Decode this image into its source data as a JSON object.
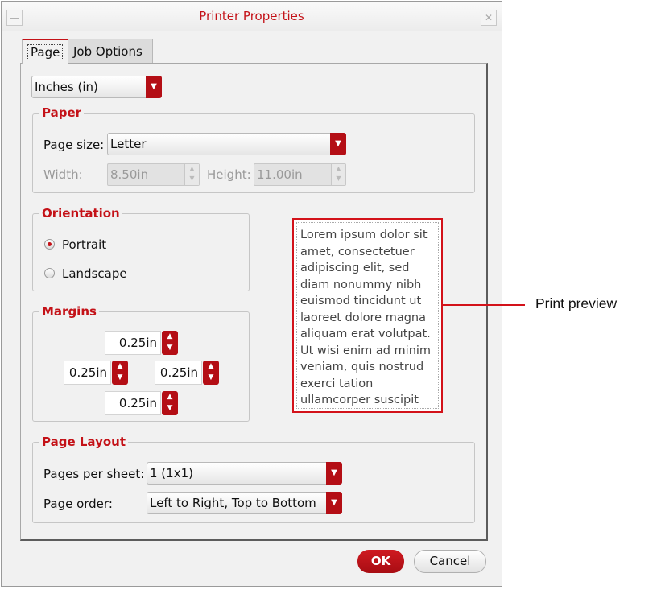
{
  "window": {
    "title": "Printer Properties"
  },
  "tabs": [
    {
      "label": "Page",
      "active": true
    },
    {
      "label": "Job Options",
      "active": false
    }
  ],
  "units": {
    "selected": "Inches (in)"
  },
  "paper": {
    "legend": "Paper",
    "page_size_label": "Page size:",
    "page_size_value": "Letter",
    "width_label": "Width:",
    "width_value": "8.50in",
    "height_label": "Height:",
    "height_value": "11.00in"
  },
  "orientation": {
    "legend": "Orientation",
    "portrait_label": "Portrait",
    "landscape_label": "Landscape",
    "selected": "Portrait"
  },
  "margins": {
    "legend": "Margins",
    "top": "0.25in",
    "left": "0.25in",
    "right": "0.25in",
    "bottom": "0.25in"
  },
  "preview": {
    "text": "Lorem ipsum dolor sit amet, consectetuer adipiscing elit, sed diam nonummy nibh euismod tincidunt ut laoreet dolore magna aliquam erat volutpat. Ut wisi enim ad minim veniam, quis nostrud exerci tation ullamcorper suscipit",
    "callout_label": "Print preview"
  },
  "page_layout": {
    "legend": "Page Layout",
    "pages_per_sheet_label": "Pages per sheet:",
    "pages_per_sheet_value": "1 (1x1)",
    "page_order_label": "Page order:",
    "page_order_value": "Left to Right, Top to Bottom"
  },
  "buttons": {
    "ok_label": "OK",
    "cancel_label": "Cancel"
  },
  "colors": {
    "accent": "#c41218",
    "button_red": "#b40e15",
    "window_bg": "#f1f1f1"
  }
}
